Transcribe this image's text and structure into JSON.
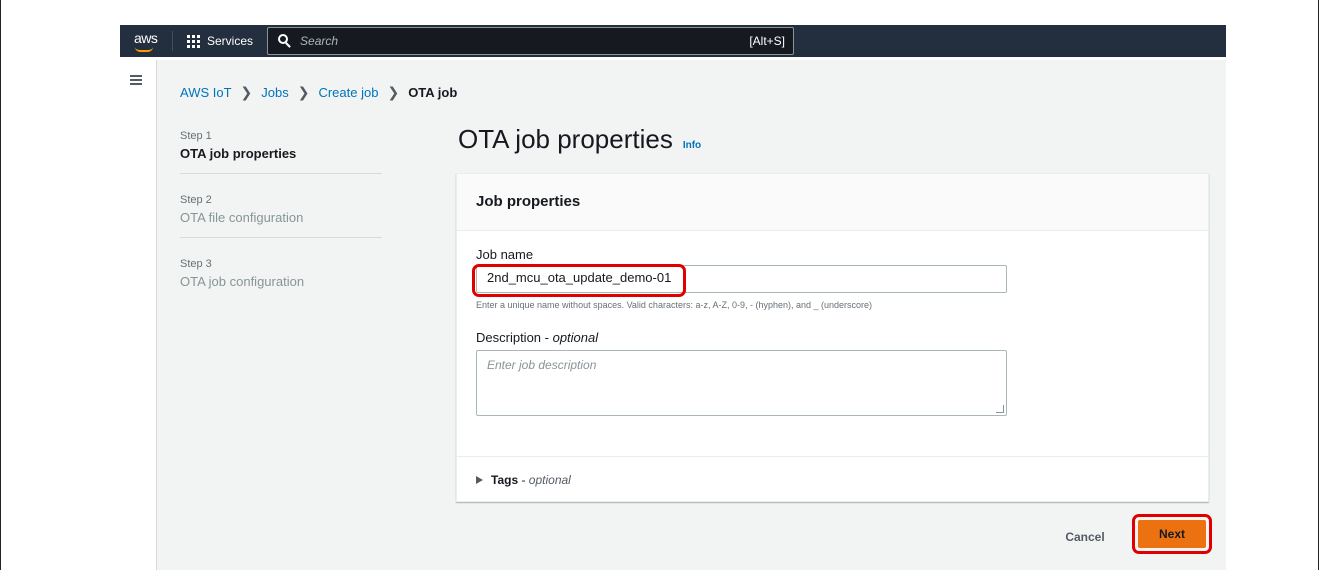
{
  "topnav": {
    "logo": "aws",
    "services_label": "Services",
    "search_placeholder": "Search",
    "search_shortcut": "[Alt+S]"
  },
  "breadcrumb": {
    "items": [
      "AWS IoT",
      "Jobs",
      "Create job"
    ],
    "current": "OTA job"
  },
  "steps": [
    {
      "num": "Step 1",
      "title": "OTA job properties",
      "active": true
    },
    {
      "num": "Step 2",
      "title": "OTA file configuration",
      "active": false
    },
    {
      "num": "Step 3",
      "title": "OTA job configuration",
      "active": false
    }
  ],
  "page": {
    "title": "OTA job properties",
    "info": "Info"
  },
  "panel": {
    "header": "Job properties",
    "job_name_label": "Job name",
    "job_name_value": "2nd_mcu_ota_update_demo-01",
    "job_name_hint": "Enter a unique name without spaces. Valid characters: a-z, A-Z, 0-9, - (hyphen), and _ (underscore)",
    "description_label": "Description",
    "description_optional": "optional",
    "description_placeholder": "Enter job description",
    "tags_label": "Tags",
    "tags_optional": "optional"
  },
  "actions": {
    "cancel": "Cancel",
    "next": "Next"
  },
  "colors": {
    "nav_bg": "#232f3e",
    "primary_button": "#ec7211",
    "link": "#0073bb",
    "highlight": "#e00000"
  }
}
